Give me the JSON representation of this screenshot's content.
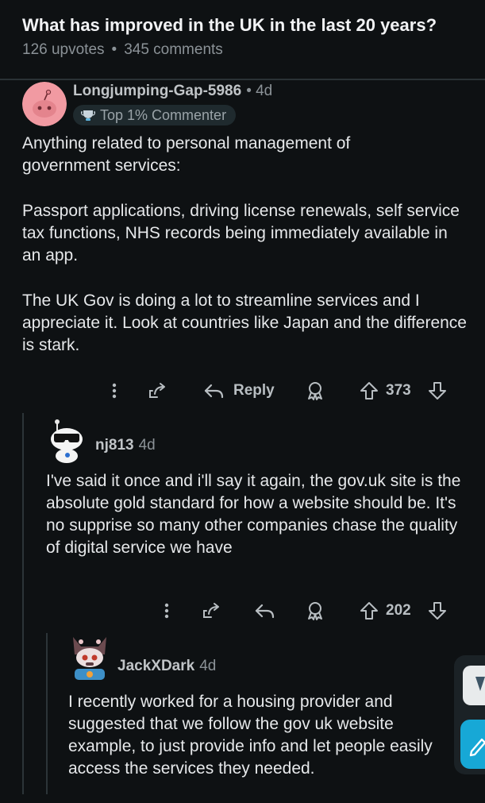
{
  "post": {
    "title": "What has improved in the UK in the last 20 years?",
    "upvotes": "126 upvotes",
    "separator": "•",
    "comments": "345 comments"
  },
  "comments": [
    {
      "username": "Longjumping-Gap-5986",
      "age": "• 4d",
      "badge": "Top 1% Commenter",
      "paragraphs": [
        "Anything related to personal management of government services:",
        "Passport applications, driving license renewals, self service tax functions, NHS records being immediately available in an app.",
        "The UK Gov is doing a lot to streamline services and I appreciate it. Look at countries like Japan and the difference is stark."
      ],
      "reply_label": "Reply",
      "votes": "373"
    },
    {
      "username": "nj813",
      "age": "4d",
      "paragraphs": [
        "I've said it once and i'll say it again, the gov.uk site is the absolute gold standard for how a website should be. It's no supprise so many other companies chase the quality of digital service we have"
      ],
      "votes": "202"
    },
    {
      "username": "JackXDark",
      "age": "4d",
      "paragraphs": [
        "I recently worked for a housing provider and suggested that we follow the gov uk website example, to just provide info and let people easily access the services they needed."
      ]
    }
  ]
}
